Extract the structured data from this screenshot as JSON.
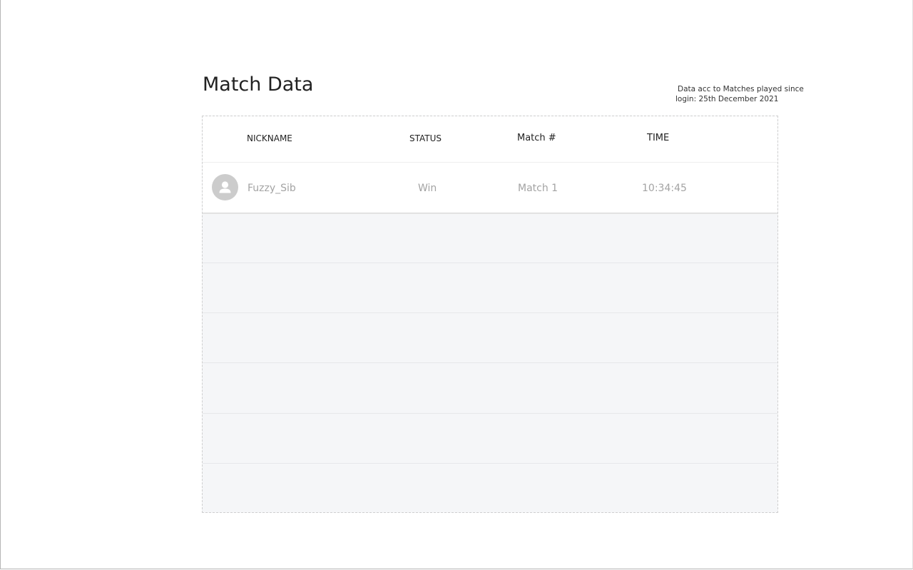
{
  "page": {
    "title": "Match Data",
    "note_line1": "Data acc to Matches played since",
    "note_line2": "login: 25th December 2021"
  },
  "table": {
    "columns": [
      "NICKNAME",
      "STATUS",
      "Match #",
      "TIME"
    ],
    "rows": [
      {
        "avatar_icon": "user-icon",
        "nickname": "Fuzzy_Sib",
        "status": "Win",
        "match": "Match 1",
        "time": "10:34:45"
      }
    ],
    "empty_rows": 6
  },
  "colors": {
    "table_empty_bg": "#f5f6f8",
    "muted_text": "#a3a3a3",
    "avatar_bg": "#cccccc"
  }
}
